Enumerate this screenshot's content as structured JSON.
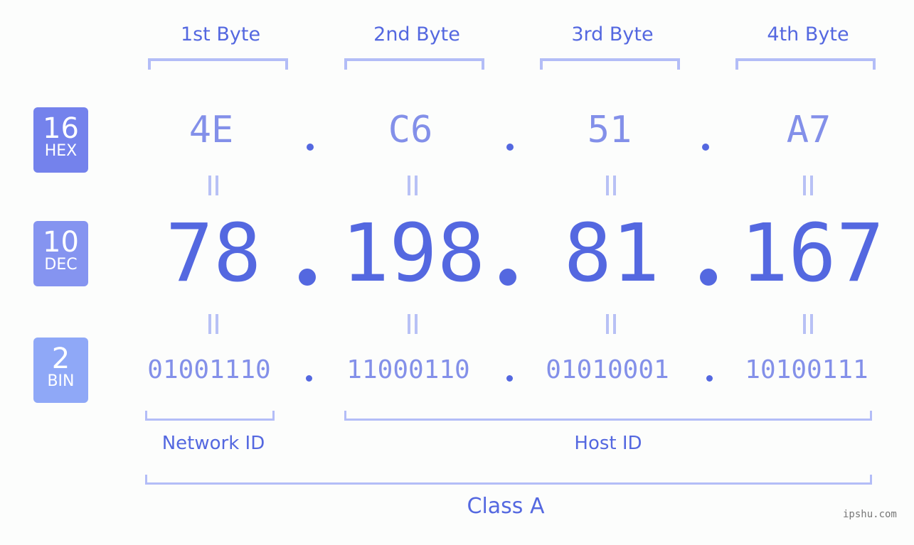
{
  "byte_labels": [
    "1st Byte",
    "2nd Byte",
    "3rd Byte",
    "4th Byte"
  ],
  "badges": {
    "hex": {
      "num": "16",
      "unit": "HEX",
      "color": "#7482ec"
    },
    "dec": {
      "num": "10",
      "unit": "DEC",
      "color": "#8594f0"
    },
    "bin": {
      "num": "2",
      "unit": "BIN",
      "color": "#8fa8f7"
    }
  },
  "hex_values": [
    "4E",
    "C6",
    "51",
    "A7"
  ],
  "dec_values": [
    "78",
    "198",
    "81",
    "167"
  ],
  "bin_values": [
    "01001110",
    "11000110",
    "01010001",
    "10100111"
  ],
  "segments": {
    "network_id": "Network ID",
    "host_id": "Host ID",
    "class": "Class A"
  },
  "watermark": "ipshu.com"
}
